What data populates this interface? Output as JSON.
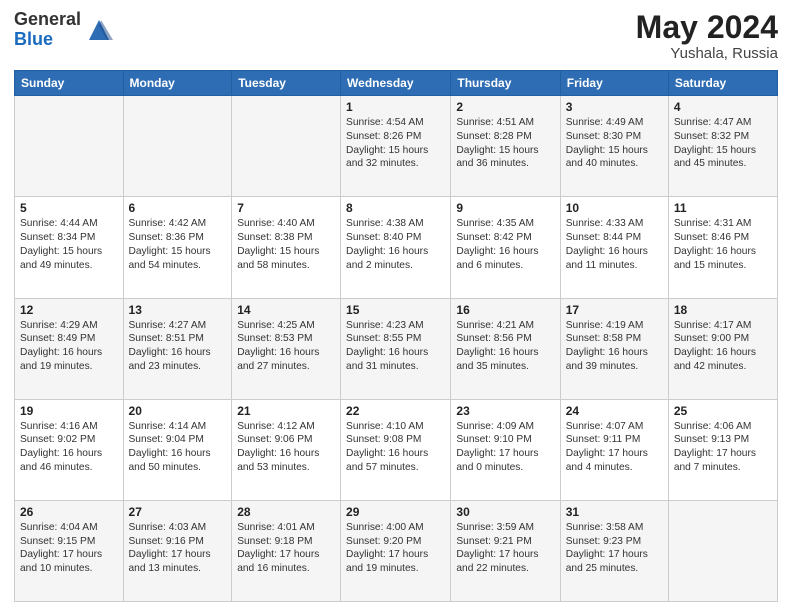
{
  "logo": {
    "general": "General",
    "blue": "Blue"
  },
  "header": {
    "month_year": "May 2024",
    "location": "Yushala, Russia"
  },
  "weekdays": [
    "Sunday",
    "Monday",
    "Tuesday",
    "Wednesday",
    "Thursday",
    "Friday",
    "Saturday"
  ],
  "weeks": [
    [
      {
        "day": "",
        "info": ""
      },
      {
        "day": "",
        "info": ""
      },
      {
        "day": "",
        "info": ""
      },
      {
        "day": "1",
        "info": "Sunrise: 4:54 AM\nSunset: 8:26 PM\nDaylight: 15 hours\nand 32 minutes."
      },
      {
        "day": "2",
        "info": "Sunrise: 4:51 AM\nSunset: 8:28 PM\nDaylight: 15 hours\nand 36 minutes."
      },
      {
        "day": "3",
        "info": "Sunrise: 4:49 AM\nSunset: 8:30 PM\nDaylight: 15 hours\nand 40 minutes."
      },
      {
        "day": "4",
        "info": "Sunrise: 4:47 AM\nSunset: 8:32 PM\nDaylight: 15 hours\nand 45 minutes."
      }
    ],
    [
      {
        "day": "5",
        "info": "Sunrise: 4:44 AM\nSunset: 8:34 PM\nDaylight: 15 hours\nand 49 minutes."
      },
      {
        "day": "6",
        "info": "Sunrise: 4:42 AM\nSunset: 8:36 PM\nDaylight: 15 hours\nand 54 minutes."
      },
      {
        "day": "7",
        "info": "Sunrise: 4:40 AM\nSunset: 8:38 PM\nDaylight: 15 hours\nand 58 minutes."
      },
      {
        "day": "8",
        "info": "Sunrise: 4:38 AM\nSunset: 8:40 PM\nDaylight: 16 hours\nand 2 minutes."
      },
      {
        "day": "9",
        "info": "Sunrise: 4:35 AM\nSunset: 8:42 PM\nDaylight: 16 hours\nand 6 minutes."
      },
      {
        "day": "10",
        "info": "Sunrise: 4:33 AM\nSunset: 8:44 PM\nDaylight: 16 hours\nand 11 minutes."
      },
      {
        "day": "11",
        "info": "Sunrise: 4:31 AM\nSunset: 8:46 PM\nDaylight: 16 hours\nand 15 minutes."
      }
    ],
    [
      {
        "day": "12",
        "info": "Sunrise: 4:29 AM\nSunset: 8:49 PM\nDaylight: 16 hours\nand 19 minutes."
      },
      {
        "day": "13",
        "info": "Sunrise: 4:27 AM\nSunset: 8:51 PM\nDaylight: 16 hours\nand 23 minutes."
      },
      {
        "day": "14",
        "info": "Sunrise: 4:25 AM\nSunset: 8:53 PM\nDaylight: 16 hours\nand 27 minutes."
      },
      {
        "day": "15",
        "info": "Sunrise: 4:23 AM\nSunset: 8:55 PM\nDaylight: 16 hours\nand 31 minutes."
      },
      {
        "day": "16",
        "info": "Sunrise: 4:21 AM\nSunset: 8:56 PM\nDaylight: 16 hours\nand 35 minutes."
      },
      {
        "day": "17",
        "info": "Sunrise: 4:19 AM\nSunset: 8:58 PM\nDaylight: 16 hours\nand 39 minutes."
      },
      {
        "day": "18",
        "info": "Sunrise: 4:17 AM\nSunset: 9:00 PM\nDaylight: 16 hours\nand 42 minutes."
      }
    ],
    [
      {
        "day": "19",
        "info": "Sunrise: 4:16 AM\nSunset: 9:02 PM\nDaylight: 16 hours\nand 46 minutes."
      },
      {
        "day": "20",
        "info": "Sunrise: 4:14 AM\nSunset: 9:04 PM\nDaylight: 16 hours\nand 50 minutes."
      },
      {
        "day": "21",
        "info": "Sunrise: 4:12 AM\nSunset: 9:06 PM\nDaylight: 16 hours\nand 53 minutes."
      },
      {
        "day": "22",
        "info": "Sunrise: 4:10 AM\nSunset: 9:08 PM\nDaylight: 16 hours\nand 57 minutes."
      },
      {
        "day": "23",
        "info": "Sunrise: 4:09 AM\nSunset: 9:10 PM\nDaylight: 17 hours\nand 0 minutes."
      },
      {
        "day": "24",
        "info": "Sunrise: 4:07 AM\nSunset: 9:11 PM\nDaylight: 17 hours\nand 4 minutes."
      },
      {
        "day": "25",
        "info": "Sunrise: 4:06 AM\nSunset: 9:13 PM\nDaylight: 17 hours\nand 7 minutes."
      }
    ],
    [
      {
        "day": "26",
        "info": "Sunrise: 4:04 AM\nSunset: 9:15 PM\nDaylight: 17 hours\nand 10 minutes."
      },
      {
        "day": "27",
        "info": "Sunrise: 4:03 AM\nSunset: 9:16 PM\nDaylight: 17 hours\nand 13 minutes."
      },
      {
        "day": "28",
        "info": "Sunrise: 4:01 AM\nSunset: 9:18 PM\nDaylight: 17 hours\nand 16 minutes."
      },
      {
        "day": "29",
        "info": "Sunrise: 4:00 AM\nSunset: 9:20 PM\nDaylight: 17 hours\nand 19 minutes."
      },
      {
        "day": "30",
        "info": "Sunrise: 3:59 AM\nSunset: 9:21 PM\nDaylight: 17 hours\nand 22 minutes."
      },
      {
        "day": "31",
        "info": "Sunrise: 3:58 AM\nSunset: 9:23 PM\nDaylight: 17 hours\nand 25 minutes."
      },
      {
        "day": "",
        "info": ""
      }
    ]
  ]
}
